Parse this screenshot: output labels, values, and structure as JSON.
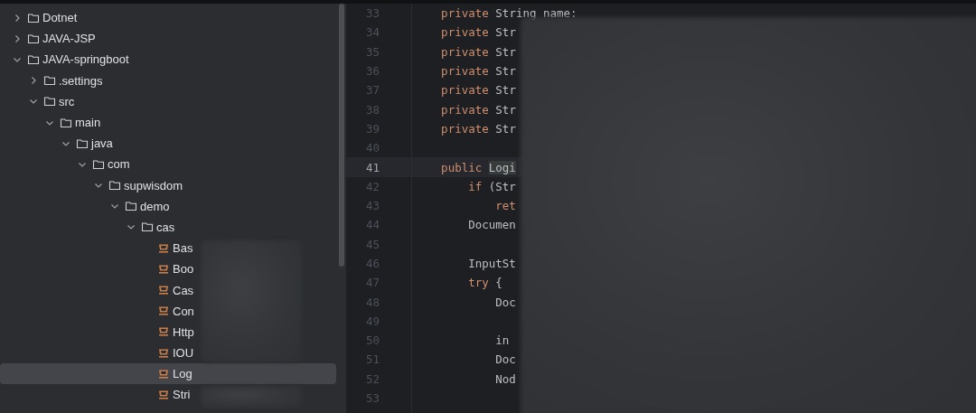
{
  "project_tree": [
    {
      "kind": "folder",
      "name": "Dotnet",
      "expanded": false,
      "selected": false
    },
    {
      "kind": "folder",
      "name": "JAVA-JSP",
      "expanded": false,
      "selected": false
    },
    {
      "kind": "folder",
      "name": "JAVA-springboot",
      "expanded": true,
      "selected": false,
      "children": [
        {
          "kind": "folder",
          "name": ".settings",
          "expanded": false,
          "selected": false
        },
        {
          "kind": "folder",
          "name": "src",
          "expanded": true,
          "selected": false,
          "children": [
            {
              "kind": "folder",
              "name": "main",
              "expanded": true,
              "selected": false,
              "children": [
                {
                  "kind": "folder",
                  "name": "java",
                  "expanded": true,
                  "selected": false,
                  "children": [
                    {
                      "kind": "folder",
                      "name": "com",
                      "expanded": true,
                      "selected": false,
                      "children": [
                        {
                          "kind": "folder",
                          "name": "supwisdom",
                          "expanded": true,
                          "selected": false,
                          "children": [
                            {
                              "kind": "folder",
                              "name": "demo",
                              "expanded": true,
                              "selected": false,
                              "children": [
                                {
                                  "kind": "folder",
                                  "name": "cas",
                                  "expanded": true,
                                  "selected": false,
                                  "children": [
                                    {
                                      "kind": "class",
                                      "name": "Bas",
                                      "selected": false
                                    },
                                    {
                                      "kind": "class",
                                      "name": "Boo",
                                      "selected": false
                                    },
                                    {
                                      "kind": "class",
                                      "name": "Cas",
                                      "selected": false
                                    },
                                    {
                                      "kind": "class",
                                      "name": "Con",
                                      "selected": false
                                    },
                                    {
                                      "kind": "class",
                                      "name": "Http",
                                      "selected": false
                                    },
                                    {
                                      "kind": "class",
                                      "name": "IOU",
                                      "selected": false
                                    },
                                    {
                                      "kind": "class",
                                      "name": "Log",
                                      "selected": true
                                    },
                                    {
                                      "kind": "class",
                                      "name": "Stri",
                                      "selected": false
                                    }
                                  ]
                                }
                              ]
                            }
                          ]
                        }
                      ]
                    }
                  ]
                }
              ]
            }
          ]
        }
      ]
    }
  ],
  "editor": {
    "lines": [
      {
        "number": "33",
        "current": false,
        "tokens": [
          {
            "kind": "keyword",
            "text": "    private "
          },
          {
            "kind": "plain",
            "text": "String name:"
          }
        ]
      },
      {
        "number": "34",
        "current": false,
        "tokens": [
          {
            "kind": "keyword",
            "text": "    private "
          },
          {
            "kind": "plain",
            "text": "Str"
          }
        ]
      },
      {
        "number": "35",
        "current": false,
        "tokens": [
          {
            "kind": "keyword",
            "text": "    private "
          },
          {
            "kind": "plain",
            "text": "Str"
          }
        ]
      },
      {
        "number": "36",
        "current": false,
        "tokens": [
          {
            "kind": "keyword",
            "text": "    private "
          },
          {
            "kind": "plain",
            "text": "Str"
          }
        ]
      },
      {
        "number": "37",
        "current": false,
        "tokens": [
          {
            "kind": "keyword",
            "text": "    private "
          },
          {
            "kind": "plain",
            "text": "Str"
          }
        ]
      },
      {
        "number": "38",
        "current": false,
        "tokens": [
          {
            "kind": "keyword",
            "text": "    private "
          },
          {
            "kind": "plain",
            "text": "Str"
          }
        ]
      },
      {
        "number": "39",
        "current": false,
        "tokens": [
          {
            "kind": "keyword",
            "text": "    private "
          },
          {
            "kind": "plain",
            "text": "Str"
          }
        ]
      },
      {
        "number": "40",
        "current": false
      },
      {
        "number": "41",
        "current": true,
        "tokens": [
          {
            "kind": "keyword",
            "text": "    public "
          },
          {
            "kind": "highlight",
            "text": "Logi"
          }
        ]
      },
      {
        "number": "42",
        "current": false,
        "tokens": [
          {
            "kind": "keyword",
            "text": "        if "
          },
          {
            "kind": "plain",
            "text": "(Str"
          }
        ]
      },
      {
        "number": "43",
        "current": false,
        "tokens": [
          {
            "kind": "keyword",
            "text": "            ret"
          }
        ]
      },
      {
        "number": "44",
        "current": false,
        "tokens": [
          {
            "kind": "plain",
            "text": "        Documen"
          }
        ]
      },
      {
        "number": "45",
        "current": false
      },
      {
        "number": "46",
        "current": false,
        "tokens": [
          {
            "kind": "plain",
            "text": "        InputSt"
          }
        ]
      },
      {
        "number": "47",
        "current": false,
        "tokens": [
          {
            "kind": "keyword",
            "text": "        try "
          },
          {
            "kind": "plain",
            "text": "{"
          }
        ]
      },
      {
        "number": "48",
        "current": false,
        "tokens": [
          {
            "kind": "plain",
            "text": "            Doc"
          }
        ]
      },
      {
        "number": "49",
        "current": false
      },
      {
        "number": "50",
        "current": false,
        "tokens": [
          {
            "kind": "plain",
            "text": "            in"
          }
        ]
      },
      {
        "number": "51",
        "current": false,
        "tokens": [
          {
            "kind": "plain",
            "text": "            Doc"
          }
        ]
      },
      {
        "number": "52",
        "current": false,
        "tokens": [
          {
            "kind": "plain",
            "text": "            Nod"
          }
        ]
      },
      {
        "number": "53",
        "current": false
      }
    ]
  }
}
